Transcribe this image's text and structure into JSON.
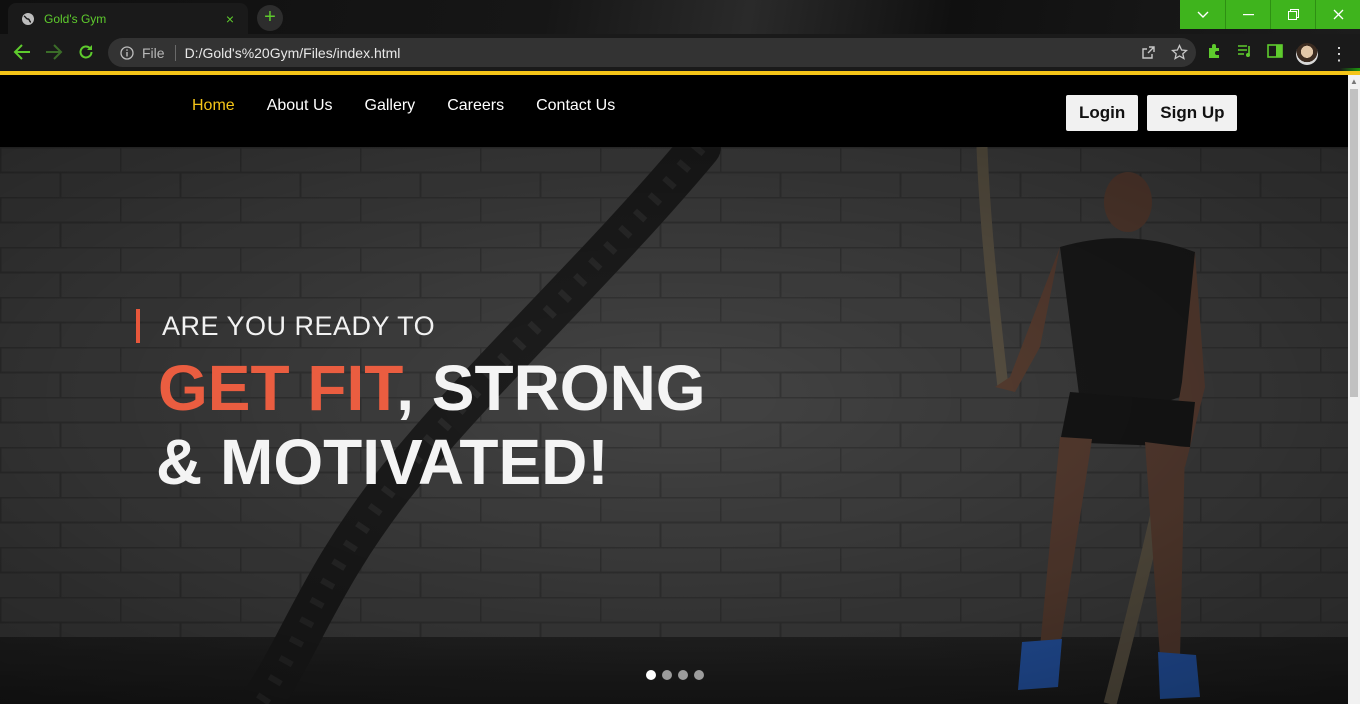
{
  "browser": {
    "tab": {
      "title": "Gold's Gym",
      "close_glyph": "×"
    },
    "new_tab_glyph": "+",
    "window_controls": {
      "tabsearch": "⌄",
      "minimize": "—",
      "restore": "❐",
      "close": "✕"
    },
    "omnibox": {
      "scheme_label": "File",
      "url": "D:/Gold's%20Gym/Files/index.html"
    },
    "accent_color": "#3fb41d",
    "text_accent_color": "#5ecb2d",
    "icons": [
      "globe-icon",
      "back-icon",
      "forward-icon",
      "reload-icon",
      "info-icon",
      "share-icon",
      "bookmark-star-icon",
      "extensions-icon",
      "media-control-icon",
      "side-panel-icon",
      "profile-avatar-icon",
      "menu-icon"
    ]
  },
  "site": {
    "nav": [
      {
        "label": "Home",
        "active": true
      },
      {
        "label": "About Us",
        "active": false
      },
      {
        "label": "Gallery",
        "active": false
      },
      {
        "label": "Careers",
        "active": false
      },
      {
        "label": "Contact Us",
        "active": false
      }
    ],
    "auth": {
      "login": "Login",
      "signup": "Sign Up"
    },
    "hero": {
      "kicker": "ARE YOU READY TO",
      "line1_highlight": "GET FIT",
      "line1_rest": ", STRONG",
      "line2": "& MOTIVATED!",
      "slides_count": 4,
      "active_slide": 1
    },
    "colors": {
      "nav_active": "#f5c518",
      "highlight": "#ea5d40",
      "border": "#f5c518"
    }
  }
}
